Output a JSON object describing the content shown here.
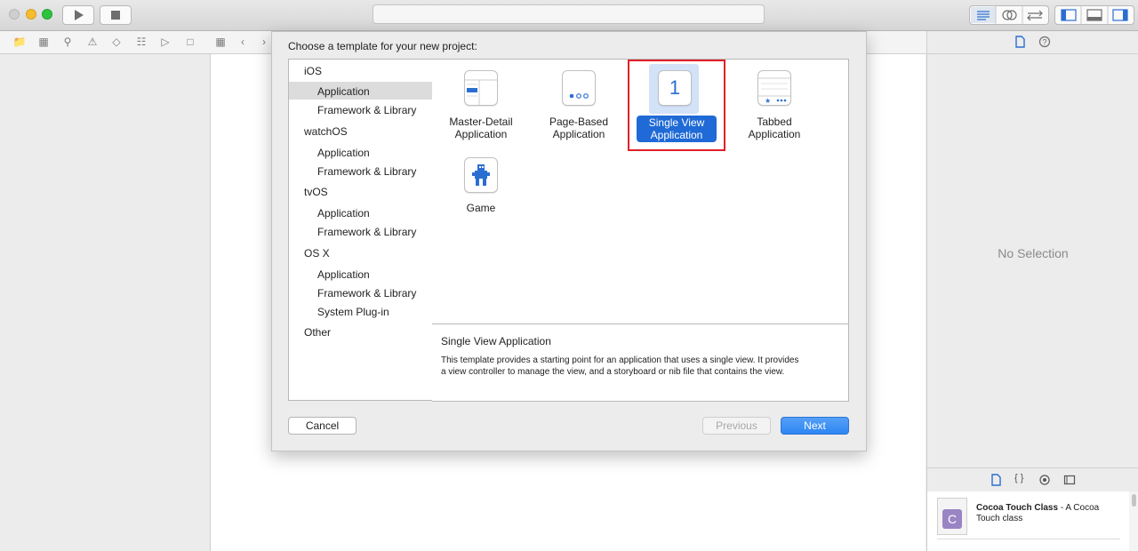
{
  "dialog": {
    "title": "Choose a template for your new project:",
    "sidebar": [
      {
        "label": "iOS",
        "items": [
          "Application",
          "Framework & Library"
        ]
      },
      {
        "label": "watchOS",
        "items": [
          "Application",
          "Framework & Library"
        ]
      },
      {
        "label": "tvOS",
        "items": [
          "Application",
          "Framework & Library"
        ]
      },
      {
        "label": "OS X",
        "items": [
          "Application",
          "Framework & Library",
          "System Plug-in"
        ]
      },
      {
        "label": "Other",
        "items": []
      }
    ],
    "selected_category": "Application",
    "templates": [
      {
        "line1": "Master-Detail",
        "line2": "Application",
        "icon": "master-detail-icon"
      },
      {
        "line1": "Page-Based",
        "line2": "Application",
        "icon": "page-based-icon"
      },
      {
        "line1": "Single View",
        "line2": "Application",
        "icon": "single-view-icon",
        "selected": true
      },
      {
        "line1": "Tabbed",
        "line2": "Application",
        "icon": "tabbed-icon"
      },
      {
        "line1": "Game",
        "line2": "",
        "icon": "game-icon"
      }
    ],
    "single_view_number": "1",
    "description": {
      "title": "Single View Application",
      "line1": "This template provides a starting point for an application that uses a single view. It provides",
      "line2": "a view controller to manage the view, and a storyboard or nib file that contains the view."
    },
    "buttons": {
      "cancel": "Cancel",
      "previous": "Previous",
      "next": "Next"
    }
  },
  "inspector": {
    "empty_text": "No Selection"
  },
  "library": {
    "item_title": "Cocoa Touch Class",
    "item_desc_inline": " - A Cocoa",
    "item_desc_line2": "Touch class",
    "item_icon_letter": "C"
  },
  "colors": {
    "accent": "#1f6ad6",
    "selection_row": "#dcdcdc",
    "highlight_border": "#e0202a",
    "next_button": "#2d86f3"
  }
}
